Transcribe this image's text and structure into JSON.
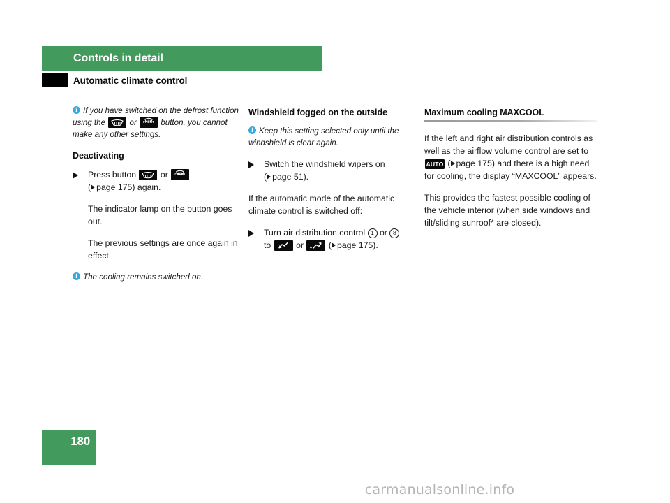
{
  "header": {
    "chapter_title": "Controls in detail",
    "section_title": "Automatic climate control",
    "bar_color": "#429a5c"
  },
  "column1": {
    "note1": {
      "icon": "info-icon",
      "text_part1": "If you have switched on the defrost function using the",
      "or_label": "or",
      "text_part2": "button, you cannot make any other settings.",
      "icons": [
        "rear-defrost-button-icon",
        "front-defrost-button-icon"
      ]
    },
    "subheading": "Deactivating",
    "step1": {
      "lead": "Press button",
      "or_label": "or",
      "ref_open": "(",
      "ref_text": "page 175",
      "ref_close": ") again.",
      "icons": [
        "rear-defrost-button-icon",
        "front-defrost-button-icon"
      ]
    },
    "para1": "The indicator lamp on the button goes out.",
    "para2": "The previous settings are once again in effect.",
    "note2": {
      "icon": "info-icon",
      "text": "The cooling remains switched on."
    }
  },
  "column2": {
    "heading": "Windshield fogged on the outside",
    "note1": {
      "icon": "info-icon",
      "text": "Keep this setting selected only until the windshield is clear again."
    },
    "step1": {
      "lead": "Switch the windshield wipers on",
      "ref_open": "(",
      "ref_text": "page 51",
      "ref_close": ")."
    },
    "para1": "If the automatic mode of the automatic climate control is switched off:",
    "step2": {
      "lead": "Turn air distribution control",
      "control_a": "1",
      "or_label_1": "or",
      "control_b": "8",
      "to_label": "to",
      "or_label_2": "or",
      "ref_open": "(",
      "ref_text": "page 175",
      "ref_close": ").",
      "icons": [
        "airflow-down-button-icon",
        "airflow-up-down-button-icon"
      ]
    }
  },
  "column3": {
    "heading": "Maximum cooling MAXCOOL",
    "para1_part1": "If the left and right air distribution controls as well as the airflow volume control are set to",
    "auto_icon_label": "AUTO",
    "para1_ref_open": "(",
    "para1_ref_text": "page 175",
    "para1_part2": ") and there is a high need for cooling, the display “MAXCOOL” appears.",
    "para2": "This provides the fastest possible cooling of the vehicle interior (when side windows and tilt/sliding sunroof* are closed)."
  },
  "footer": {
    "page_number": "180",
    "watermark": "carmanualsonline.info"
  }
}
